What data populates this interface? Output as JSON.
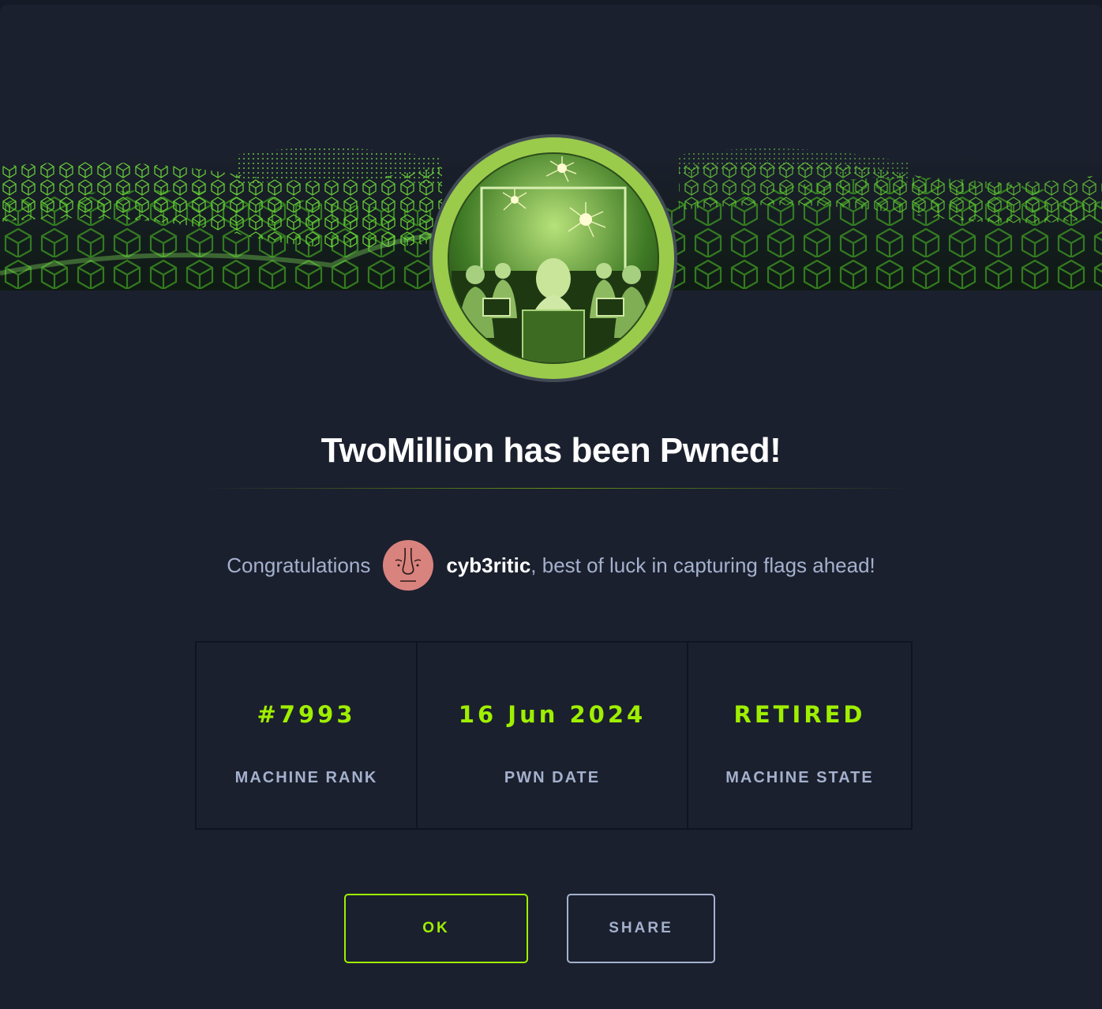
{
  "modal": {
    "title": "TwoMillion has been Pwned!",
    "congrats_prefix": "Congratulations",
    "username": "cyb3ritic",
    "congrats_suffix": ", best of luck in capturing flags ahead!"
  },
  "stats": [
    {
      "value": "#7993",
      "label": "MACHINE RANK"
    },
    {
      "value": "16 Jun 2024",
      "label": "PWN DATE"
    },
    {
      "value": "RETIRED",
      "label": "MACHINE STATE"
    }
  ],
  "buttons": {
    "ok_label": "OK",
    "share_label": "SHARE"
  },
  "colors": {
    "accent": "#9fef00",
    "background": "#1b202e",
    "muted_text": "#a4b1cd",
    "badge_ring": "#8ac43f",
    "avatar_bg": "#d9837e"
  },
  "icons": {
    "banner": "green-hex-cube-wave",
    "badge": "machine-badge-fireworks",
    "avatar": "user-avatar"
  }
}
